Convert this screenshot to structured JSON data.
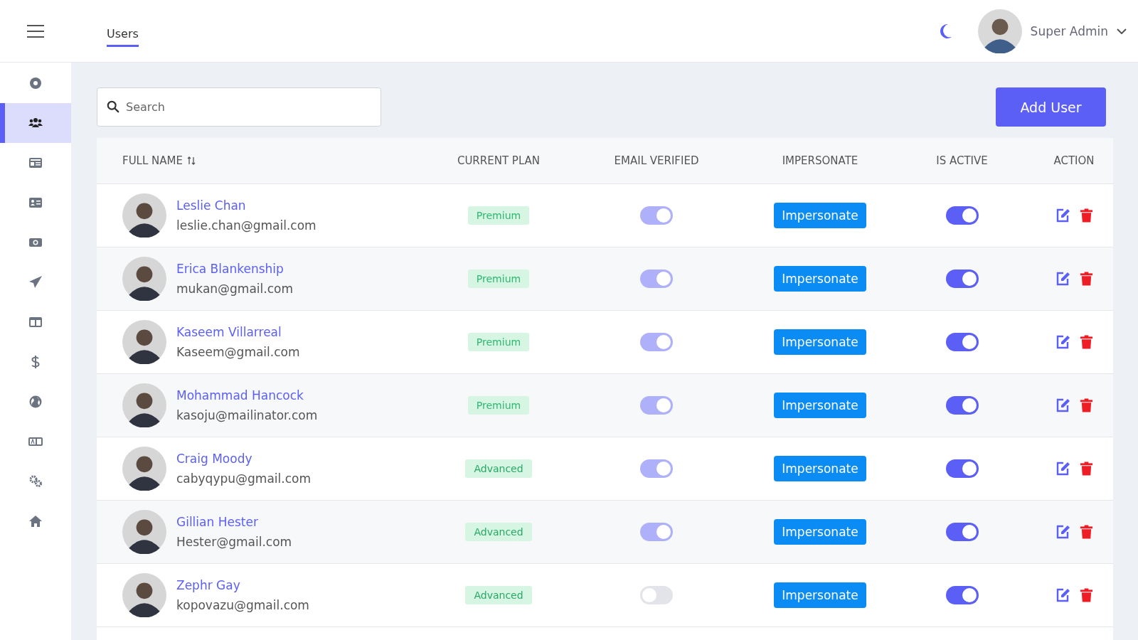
{
  "header": {
    "tabs": [
      {
        "label": "Users",
        "selected": true
      }
    ],
    "user": {
      "name": "Super Admin"
    }
  },
  "sidebar": {
    "items": [
      {
        "selected": false
      },
      {
        "selected": true
      },
      {
        "selected": false
      },
      {
        "selected": false
      },
      {
        "selected": false
      },
      {
        "selected": false
      },
      {
        "selected": false
      },
      {
        "selected": false
      },
      {
        "selected": false
      },
      {
        "selected": false
      },
      {
        "selected": false
      },
      {
        "selected": false
      }
    ]
  },
  "search": {
    "placeholder": "Search"
  },
  "add_button": "Add User",
  "table": {
    "columns": [
      {
        "label": "FULL NAME",
        "sortable": true
      },
      {
        "label": "CURRENT PLAN",
        "sortable": false
      },
      {
        "label": "EMAIL VERIFIED",
        "sortable": false
      },
      {
        "label": "IMPERSONATE",
        "sortable": false
      },
      {
        "label": "IS ACTIVE",
        "sortable": false
      },
      {
        "label": "ACTION",
        "sortable": false
      }
    ],
    "rows": [
      {
        "name": "Leslie Chan",
        "email": "leslie.chan@gmail.com",
        "plan": "Premium",
        "email_verified": true,
        "impersonate": "Impersonate",
        "is_active": true
      },
      {
        "name": "Erica Blankenship",
        "email": "mukan@gmail.com",
        "plan": "Premium",
        "email_verified": true,
        "impersonate": "Impersonate",
        "is_active": true
      },
      {
        "name": "Kaseem Villarreal",
        "email": "Kaseem@gmail.com",
        "plan": "Premium",
        "email_verified": true,
        "impersonate": "Impersonate",
        "is_active": true
      },
      {
        "name": "Mohammad Hancock",
        "email": "kasoju@mailinator.com",
        "plan": "Premium",
        "email_verified": true,
        "impersonate": "Impersonate",
        "is_active": true
      },
      {
        "name": "Craig Moody",
        "email": "cabyqypu@gmail.com",
        "plan": "Advanced",
        "email_verified": true,
        "impersonate": "Impersonate",
        "is_active": true
      },
      {
        "name": "Gillian Hester",
        "email": "Hester@gmail.com",
        "plan": "Advanced",
        "email_verified": true,
        "impersonate": "Impersonate",
        "is_active": true
      },
      {
        "name": "Zephr Gay",
        "email": "kopovazu@gmail.com",
        "plan": "Advanced",
        "email_verified": false,
        "impersonate": "Impersonate",
        "is_active": true
      }
    ]
  }
}
